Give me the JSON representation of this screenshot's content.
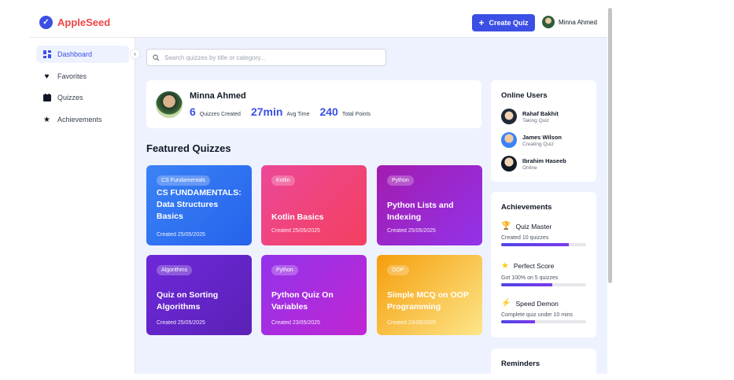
{
  "header": {
    "app_name": "AppleSeed",
    "create_label": "Create Quiz",
    "user_name": "Minna Ahmed"
  },
  "sidebar": {
    "items": [
      {
        "label": "Dashboard",
        "icon": "dashboard-icon"
      },
      {
        "label": "Favorites",
        "icon": "heart-icon"
      },
      {
        "label": "Quizzes",
        "icon": "calendar-icon"
      },
      {
        "label": "Achievements",
        "icon": "star-icon"
      }
    ]
  },
  "search": {
    "placeholder": "Search quizzes by title or category..."
  },
  "profile": {
    "name": "Minna Ahmed",
    "stats": [
      {
        "value": "6",
        "label": "Quizzes Created"
      },
      {
        "value": "27min",
        "label": "Avg Time"
      },
      {
        "value": "240",
        "label": "Total Points"
      }
    ]
  },
  "featured": {
    "title": "Featured Quizzes",
    "cards": [
      {
        "tag": "CS Fundamentals",
        "title": "CS FUNDAMENTALS: Data Structures Basics",
        "date": "Created 25/05/2025"
      },
      {
        "tag": "Kotlin",
        "title": "Kotlin Basics",
        "date": "Created 25/05/2025"
      },
      {
        "tag": "Python",
        "title": "Python Lists and Indexing",
        "date": "Created 25/05/2025"
      },
      {
        "tag": "Algorithms",
        "title": "Quiz on Sorting Algorithms",
        "date": "Created 25/05/2025"
      },
      {
        "tag": "Python",
        "title": "Python Quiz On Variables",
        "date": "Created 23/05/2025"
      },
      {
        "tag": "OOP",
        "title": "Simple MCQ on OOP Programming",
        "date": "Created 23/05/2025"
      }
    ]
  },
  "online_users": {
    "title": "Online Users",
    "users": [
      {
        "name": "Rahaf Bakhit",
        "status": "Taking Quiz"
      },
      {
        "name": "James Wilson",
        "status": "Creating Quiz"
      },
      {
        "name": "Ibrahim Haseeb",
        "status": "Online"
      }
    ]
  },
  "achievements": {
    "title": "Achievements",
    "items": [
      {
        "icon": "trophy-icon",
        "name": "Quiz Master",
        "desc": "Created 10 quizzes",
        "progress": 0.8
      },
      {
        "icon": "star-icon",
        "name": "Perfect Score",
        "desc": "Got 100% on 5 quizzes",
        "progress": 0.6
      },
      {
        "icon": "lightning-icon",
        "name": "Speed Demon",
        "desc": "Complete quiz under 10 mins",
        "progress": 0.4
      }
    ]
  },
  "reminders": {
    "title": "Reminders"
  }
}
